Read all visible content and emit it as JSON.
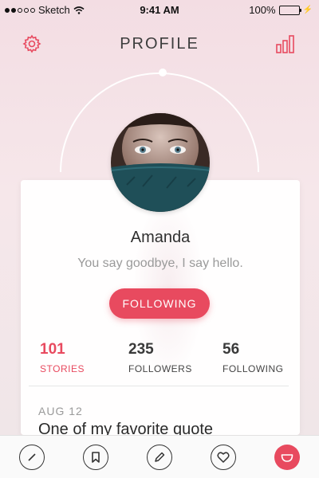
{
  "status_bar": {
    "carrier": "Sketch",
    "time": "9:41 AM",
    "battery": "100%",
    "battery_level": 1.0
  },
  "header": {
    "title": "PROFILE",
    "left_icon": "gear-icon",
    "right_icon": "bar-chart-icon"
  },
  "profile": {
    "name": "Amanda",
    "bio": "You say goodbye, I say hello.",
    "follow_button_label": "FOLLOWING"
  },
  "stats": [
    {
      "value": "101",
      "label": "STORIES",
      "active": true
    },
    {
      "value": "235",
      "label": "FOLLOWERS",
      "active": false
    },
    {
      "value": "56",
      "label": "FOLLOWING",
      "active": false
    }
  ],
  "post": {
    "date": "AUG 12",
    "title": "One of my favorite quote"
  },
  "tab_bar": {
    "items": [
      {
        "icon": "slash-circle-icon",
        "active": false
      },
      {
        "icon": "bookmark-icon",
        "active": false
      },
      {
        "icon": "pencil-icon",
        "active": false
      },
      {
        "icon": "heart-icon",
        "active": false
      },
      {
        "icon": "smile-icon",
        "active": true
      }
    ]
  },
  "colors": {
    "accent": "#e84a5f",
    "text_primary": "#2f2f2f",
    "text_muted": "#9a9a9a",
    "battery": "#4cd964"
  }
}
